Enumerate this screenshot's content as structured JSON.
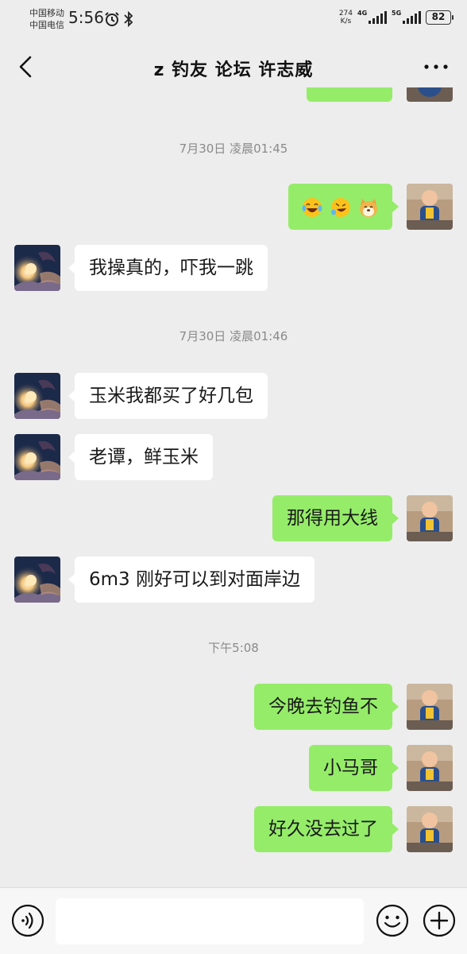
{
  "status_bar": {
    "carrier_1": "中国移动",
    "carrier_2": "中国电信",
    "time": "5:56",
    "net_speed_value": "274",
    "net_speed_unit": "K/s",
    "network_1": "4G",
    "network_2": "5G",
    "battery": "82"
  },
  "header": {
    "title": "z  钓友 论坛  许志威"
  },
  "messages": [
    {
      "type": "time",
      "text": "7月30日 凌晨01:45"
    },
    {
      "side": "right",
      "type": "emoji",
      "emojis": [
        "laughing-tears-emoji",
        "rolling-laugh-emoji",
        "dog-face-emoji"
      ]
    },
    {
      "side": "left",
      "text": "我操真的，吓我一跳"
    },
    {
      "type": "time",
      "text": "7月30日 凌晨01:46"
    },
    {
      "side": "left",
      "text": "玉米我都买了好几包"
    },
    {
      "side": "left",
      "text": "老谭，鲜玉米"
    },
    {
      "side": "right",
      "text": "那得用大线"
    },
    {
      "side": "left",
      "text": "6m3 刚好可以到对面岸边"
    },
    {
      "type": "time",
      "text": "下午5:08"
    },
    {
      "side": "right",
      "text": "今晚去钓鱼不"
    },
    {
      "side": "right",
      "text": "小马哥"
    },
    {
      "side": "right",
      "text": "好久没去过了"
    }
  ],
  "input": {
    "value": "",
    "placeholder": ""
  },
  "colors": {
    "background": "#ededed",
    "sent_bubble": "#95ec69",
    "received_bubble": "#ffffff",
    "timestamp_text": "#8a8a8a"
  }
}
